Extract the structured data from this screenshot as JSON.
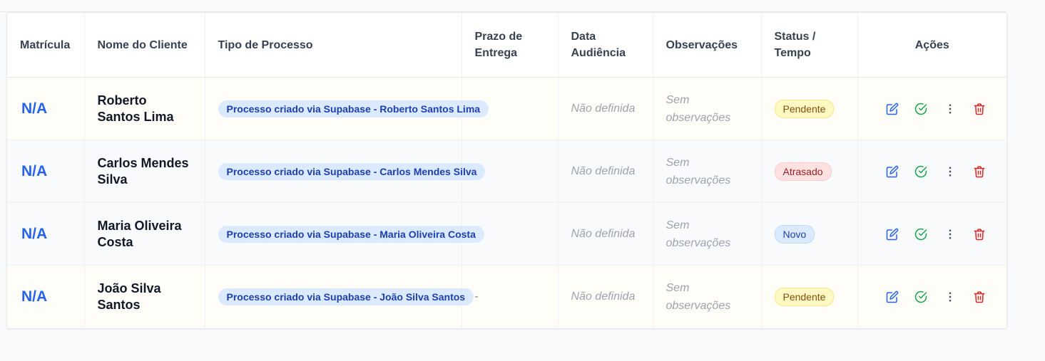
{
  "table": {
    "headers": {
      "matricula": "Matrícula",
      "nome": "Nome do Cliente",
      "tipo": "Tipo de Processo",
      "prazo": "Prazo de Entrega",
      "audiencia": "Data Audiência",
      "observacoes": "Observações",
      "status": "Status / Tempo",
      "acoes": "Ações"
    },
    "rows": [
      {
        "matricula": "N/A",
        "nome": "Roberto Santos Lima",
        "tipo": "Processo criado via Supabase - Roberto Santos Lima",
        "prazo": "-",
        "audiencia": "Não definida",
        "observacoes": "Sem observações",
        "status": "Pendente",
        "status_kind": "pendente"
      },
      {
        "matricula": "N/A",
        "nome": "Carlos Mendes Silva",
        "tipo": "Processo criado via Supabase - Carlos Mendes Silva",
        "prazo": "-",
        "audiencia": "Não definida",
        "observacoes": "Sem observações",
        "status": "Atrasado",
        "status_kind": "atrasado"
      },
      {
        "matricula": "N/A",
        "nome": "Maria Oliveira Costa",
        "tipo": "Processo criado via Supabase - Maria Oliveira Costa",
        "prazo": "-",
        "audiencia": "Não definida",
        "observacoes": "Sem observações",
        "status": "Novo",
        "status_kind": "novo"
      },
      {
        "matricula": "N/A",
        "nome": "João Silva Santos",
        "tipo": "Processo criado via Supabase - João Silva Santos",
        "prazo": "-",
        "audiencia": "Não definida",
        "observacoes": "Sem observações",
        "status": "Pendente",
        "status_kind": "pendente"
      }
    ],
    "action_icons": [
      "edit-icon",
      "check-circle-icon",
      "more-vertical-icon",
      "trash-icon"
    ]
  },
  "colors": {
    "accent": "#2563eb",
    "success": "#16a34a",
    "danger": "#dc2626",
    "muted": "#6b7280"
  }
}
